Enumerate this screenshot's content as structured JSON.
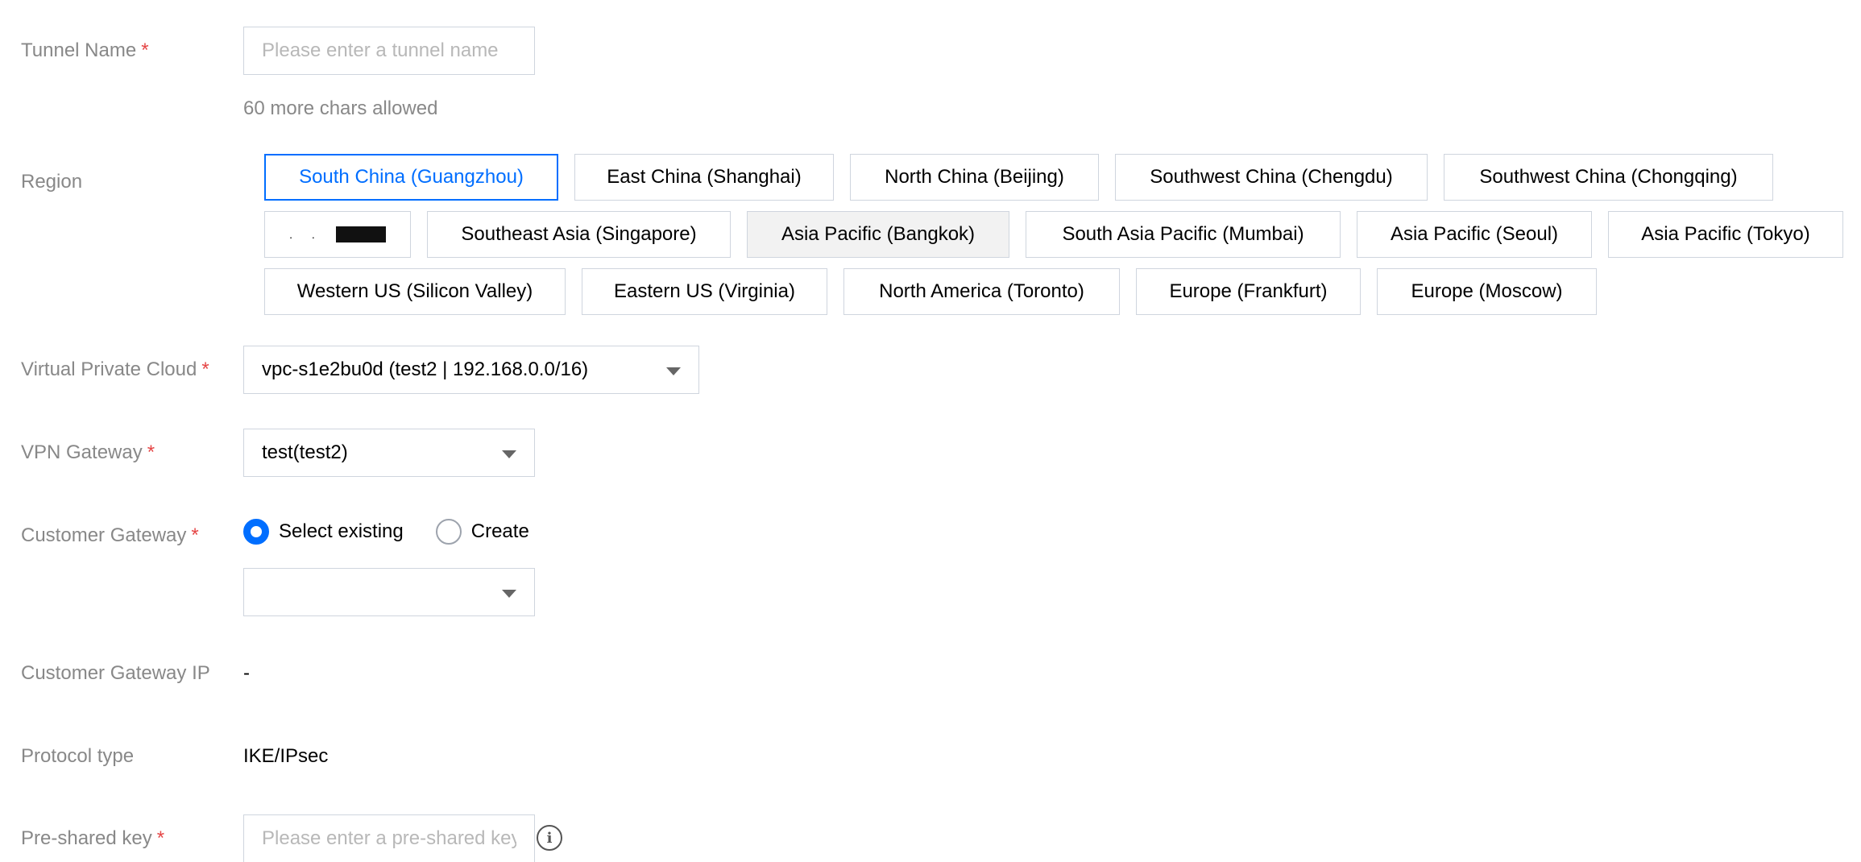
{
  "tunnel_name": {
    "label": "Tunnel Name",
    "required_mark": "*",
    "placeholder": "Please enter a tunnel name",
    "value": "",
    "hint": "60 more chars allowed"
  },
  "region": {
    "label": "Region",
    "options": [
      {
        "label": "South China (Guangzhou)",
        "state": "selected"
      },
      {
        "label": "East China (Shanghai)",
        "state": "normal"
      },
      {
        "label": "North China (Beijing)",
        "state": "normal"
      },
      {
        "label": "Southwest China (Chengdu)",
        "state": "normal"
      },
      {
        "label": "Southwest China (Chongqing)",
        "state": "normal"
      },
      {
        "label": "",
        "state": "redacted"
      },
      {
        "label": "Southeast Asia (Singapore)",
        "state": "normal"
      },
      {
        "label": "Asia Pacific (Bangkok)",
        "state": "disabled"
      },
      {
        "label": "South Asia Pacific (Mumbai)",
        "state": "normal"
      },
      {
        "label": "Asia Pacific (Seoul)",
        "state": "normal"
      },
      {
        "label": "Asia Pacific (Tokyo)",
        "state": "normal"
      },
      {
        "label": "Western US (Silicon Valley)",
        "state": "normal"
      },
      {
        "label": "Eastern US (Virginia)",
        "state": "normal"
      },
      {
        "label": "North America (Toronto)",
        "state": "normal"
      },
      {
        "label": "Europe (Frankfurt)",
        "state": "normal"
      },
      {
        "label": "Europe (Moscow)",
        "state": "normal"
      }
    ]
  },
  "vpc": {
    "label": "Virtual Private Cloud",
    "required_mark": "*",
    "value": "vpc-s1e2bu0d (test2 | 192.168.0.0/16)"
  },
  "vpn_gateway": {
    "label": "VPN Gateway",
    "required_mark": "*",
    "value": "test(test2)"
  },
  "customer_gateway": {
    "label": "Customer Gateway",
    "required_mark": "*",
    "radio_options": [
      {
        "label": "Select existing",
        "checked": true
      },
      {
        "label": "Create",
        "checked": false
      }
    ],
    "select_value": ""
  },
  "customer_gateway_ip": {
    "label": "Customer Gateway IP",
    "value": "-"
  },
  "protocol_type": {
    "label": "Protocol type",
    "value": "IKE/IPsec"
  },
  "pre_shared_key": {
    "label": "Pre-shared key",
    "required_mark": "*",
    "placeholder": "Please enter a pre-shared key",
    "value": ""
  },
  "colors": {
    "accent": "#006eff",
    "required": "#e54545",
    "label": "#888888",
    "border": "#cfd5de",
    "disabled_bg": "#f2f2f2"
  },
  "icons": {
    "dropdown": "caret-down-icon",
    "info": "info-circle-icon"
  }
}
